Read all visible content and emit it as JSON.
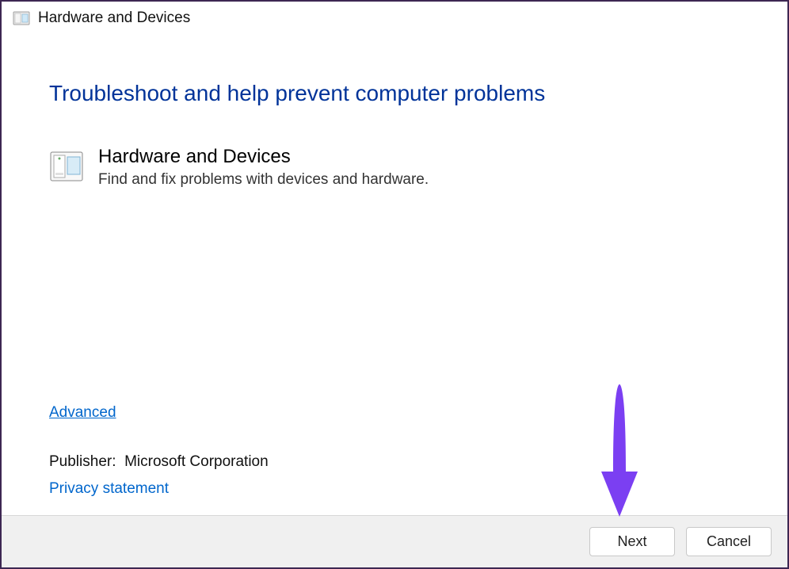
{
  "window": {
    "title": "Hardware and Devices"
  },
  "main": {
    "heading": "Troubleshoot and help prevent computer problems",
    "troubleshooter": {
      "title": "Hardware and Devices",
      "description": "Find and fix problems with devices and hardware."
    },
    "advanced_link": "Advanced",
    "publisher_label": "Publisher:",
    "publisher_value": "Microsoft Corporation",
    "privacy_link": "Privacy statement"
  },
  "footer": {
    "next_label": "Next",
    "cancel_label": "Cancel"
  },
  "colors": {
    "heading": "#003399",
    "link": "#0066cc",
    "arrow": "#7b3ff2"
  }
}
